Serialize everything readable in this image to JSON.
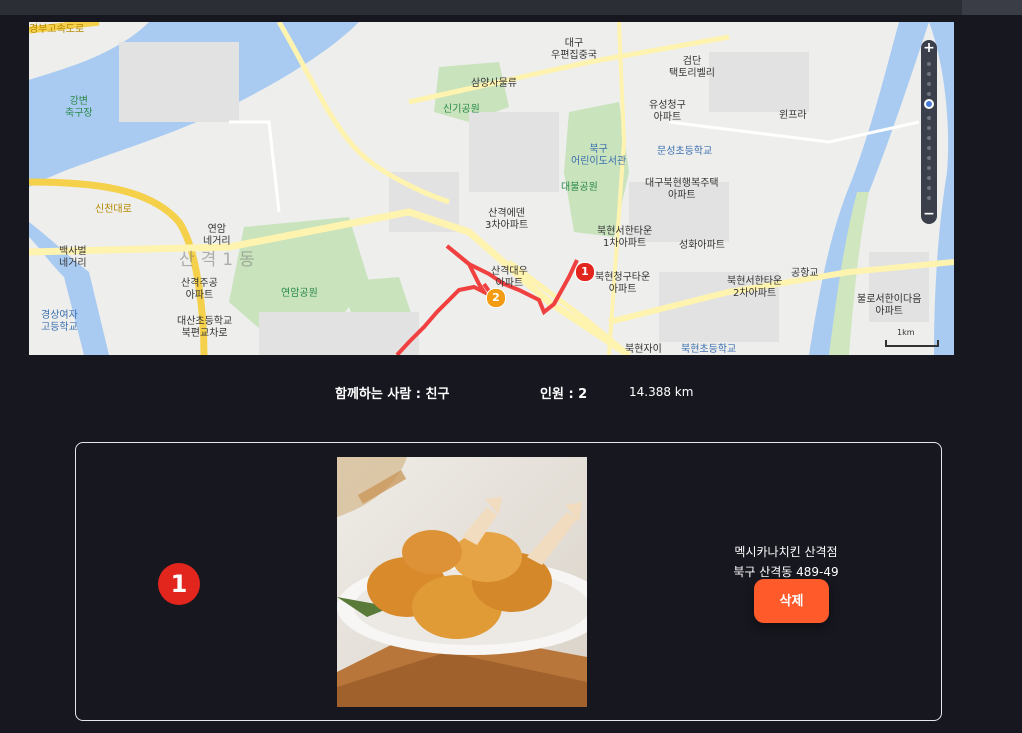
{
  "map": {
    "labels": {
      "expressway": "경부고속도로",
      "gangbyeon": "강변\n축구장",
      "daegu_post": "대구\n우편집중국",
      "geomdan": "검단\n택토리벨리",
      "samyang": "삼양사물류",
      "singi_park": "신기공원",
      "yuseong": "유성청구\n아파트",
      "winpra": "윈프라",
      "bukgu_library": "북구\n어린이도서관",
      "munseong_school": "문성초등학교",
      "daebul_park": "대불공원",
      "bukhyun_happy": "대구북현행복주택\n아파트",
      "sincheon_daero": "신천대로",
      "yeonam_gori": "연암\n네거리",
      "baeksa_gori": "백사벌\n네거리",
      "sangyeok_mellon": "산격에덴\n3차아파트",
      "bukhyun_1": "북현서한타운\n1차아파트",
      "seonghwa": "성화아파트",
      "sangyeok_dong": "산격1동",
      "sangyeok_jugong": "산격주공\n아파트",
      "yeonam_park": "연암공원",
      "sangyeok_daewoo": "산격대우\n아파트",
      "bukhyun_cheonggu": "북현청구타운\n아파트",
      "bukhyun_2": "북현서한타운\n2차아파트",
      "gongdanggyo": "공항교",
      "bulro": "불로서한이다음\n아파트",
      "gyeongsang_girls": "경상여자\n고등학교",
      "daesan_school": "대산초등학교\n북편교차로",
      "bukhyun_jai": "북현자이",
      "bukhyun_school": "북현초등학교",
      "scale": "1km"
    },
    "markers": [
      {
        "number": "1",
        "color": "#e2261d"
      },
      {
        "number": "2",
        "color": "#f39c12"
      }
    ],
    "zoom": {
      "plus": "+",
      "minus": "−"
    }
  },
  "info": {
    "companion_label": "함께하는 사람 : 친구",
    "people_label": "인원 : 2",
    "distance": "14.388 km"
  },
  "stops": [
    {
      "number": "1",
      "store_name": "멕시카나치킨 산격점",
      "address": "북구 산격동 489-49",
      "delete_label": "삭제"
    }
  ]
}
